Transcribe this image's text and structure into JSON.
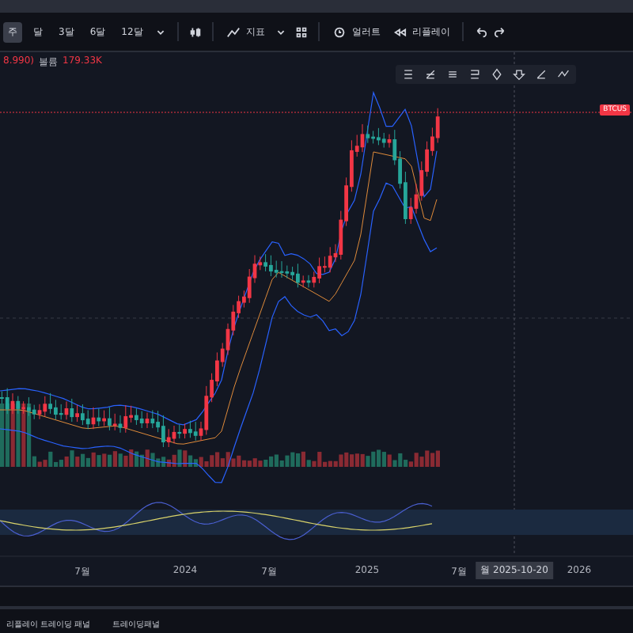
{
  "toolbar": {
    "intervals": [
      {
        "label": "주",
        "selected": true
      },
      {
        "label": "달",
        "selected": false
      },
      {
        "label": "3달",
        "selected": false
      },
      {
        "label": "6달",
        "selected": false
      },
      {
        "label": "12달",
        "selected": false
      }
    ],
    "indicators": "지표",
    "alert": "얼러트",
    "replay": "리플레이"
  },
  "legend": {
    "prefix": "8.990)",
    "volume_label": "볼륨",
    "volume_value": "179.33K"
  },
  "price_tag": "BTCUS",
  "time_axis": {
    "labels": [
      "7월",
      "2024",
      "7월",
      "2025",
      "7월"
    ],
    "cursor_label": "월 2025-10-20",
    "end_label": "2026"
  },
  "bottom_tabs": [
    {
      "label": "리플레이 트레이딩 패널",
      "selected": false
    },
    {
      "label": "트레이딩패널",
      "selected": false
    }
  ]
}
